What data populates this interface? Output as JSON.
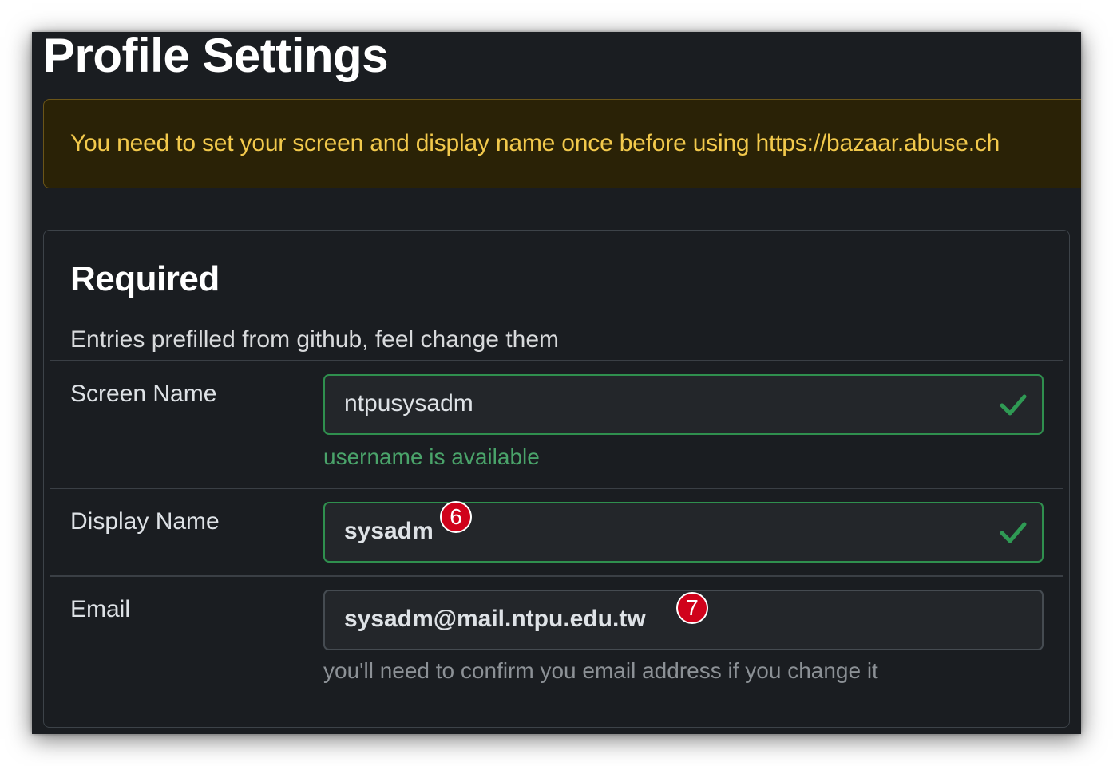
{
  "page": {
    "title": "Profile Settings"
  },
  "alert": {
    "text": "You need to set your screen and display name once before using https://bazaar.abuse.ch"
  },
  "card": {
    "title": "Required",
    "subtitle": "Entries prefilled from github, feel change them"
  },
  "fields": {
    "screen_name": {
      "label": "Screen Name",
      "value": "ntpusysadm",
      "status": "valid",
      "feedback": "username is available"
    },
    "display_name": {
      "label": "Display Name",
      "value": "sysadm",
      "status": "valid",
      "badge": "6"
    },
    "email": {
      "label": "Email",
      "value": "sysadm@mail.ntpu.edu.tw",
      "badge": "7",
      "help": "you'll need to confirm you email address if you change it"
    }
  },
  "colors": {
    "background": "#1a1d21",
    "alert_text": "#f2c94c",
    "alert_bg": "#2a2206",
    "valid_border": "#2f8f4e",
    "valid_text": "#4aa36a",
    "badge": "#d0021b"
  },
  "icons": {
    "valid": "check-icon"
  }
}
